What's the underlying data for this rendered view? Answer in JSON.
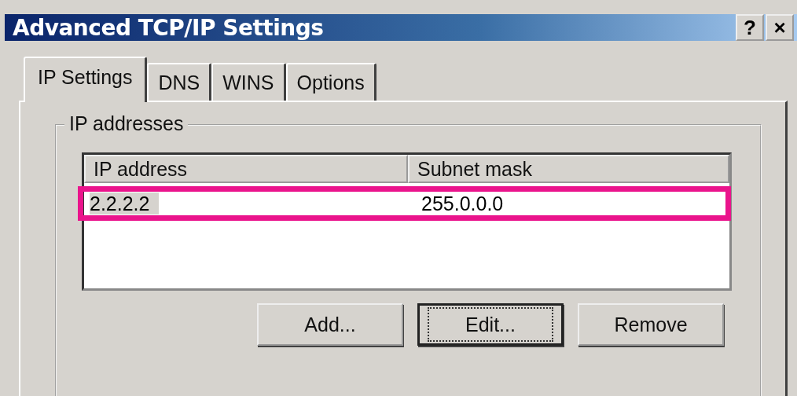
{
  "window": {
    "title": "Advanced TCP/IP Settings",
    "title_buttons": [
      "?",
      "×"
    ]
  },
  "tabs": [
    {
      "label": "IP Settings",
      "selected": true
    },
    {
      "label": "DNS",
      "selected": false
    },
    {
      "label": "WINS",
      "selected": false
    },
    {
      "label": "Options",
      "selected": false
    }
  ],
  "group": {
    "label": "IP addresses"
  },
  "table": {
    "columns": [
      "IP address",
      "Subnet mask"
    ],
    "rows": [
      {
        "cells": [
          "2.2.2.2",
          "255.0.0.0"
        ],
        "selected": true,
        "highlighted": true
      }
    ]
  },
  "buttons": [
    {
      "label": "Add...",
      "focused": false
    },
    {
      "label": "Edit...",
      "focused": true
    },
    {
      "label": "Remove",
      "focused": false
    }
  ]
}
